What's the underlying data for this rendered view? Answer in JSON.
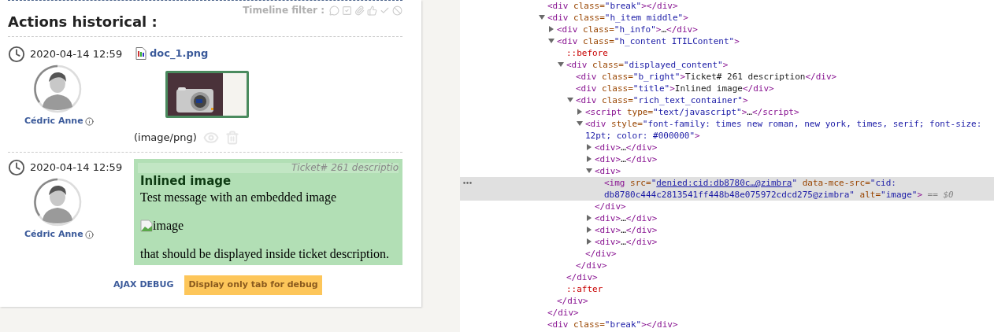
{
  "timeline": {
    "title": "Actions historical :",
    "filter_label": "Timeline filter :",
    "items": [
      {
        "kind": "document",
        "date": "2020-04-14 12:59",
        "author": "Cédric Anne",
        "file": "doc_1.png",
        "mime": "(image/png)"
      },
      {
        "kind": "description",
        "date": "2020-04-14 12:59",
        "author": "Cédric Anne",
        "ticket": "Ticket# 261 descriptio",
        "heading": "Inlined image",
        "text": "Test message with an embedded image",
        "image_alt": "image",
        "closing": "that should be displayed inside ticket description."
      }
    ],
    "debug_link": "AJAX DEBUG",
    "debug_button": "Display only tab for debug"
  },
  "inspector": {
    "nodes": [
      {
        "kind": "leaf",
        "selected": false,
        "line": [
          {
            "kind": "tag",
            "text": "<div"
          },
          {
            "kind": "attr",
            "text": " class="
          },
          {
            "kind": "val",
            "text": "\"break\""
          },
          {
            "kind": "tag",
            "text": "></div>"
          }
        ]
      },
      {
        "kind": "branch",
        "expanded": true,
        "selected": false,
        "line": [
          {
            "kind": "tag",
            "text": "<div"
          },
          {
            "kind": "attr",
            "text": " class="
          },
          {
            "kind": "val",
            "text": "\"h_item middle\""
          },
          {
            "kind": "tag",
            "text": ">"
          }
        ],
        "end": [
          {
            "kind": "tag",
            "text": "</div>"
          }
        ],
        "children": [
          {
            "kind": "branch",
            "expanded": false,
            "selected": false,
            "line": [
              {
                "kind": "tag",
                "text": "<div"
              },
              {
                "kind": "attr",
                "text": " class="
              },
              {
                "kind": "val",
                "text": "\"h_info\""
              },
              {
                "kind": "tag",
                "text": ">"
              },
              {
                "kind": "text",
                "text": "…"
              },
              {
                "kind": "tag",
                "text": "</div>"
              }
            ]
          },
          {
            "kind": "branch",
            "expanded": true,
            "selected": false,
            "line": [
              {
                "kind": "tag",
                "text": "<div"
              },
              {
                "kind": "attr",
                "text": " class="
              },
              {
                "kind": "val",
                "text": "\"h_content ITILContent\""
              },
              {
                "kind": "tag",
                "text": ">"
              }
            ],
            "end": [
              {
                "kind": "tag",
                "text": "</div>"
              }
            ],
            "children": [
              {
                "kind": "leaf",
                "selected": false,
                "line": [
                  {
                    "kind": "pseudo",
                    "text": "::before"
                  }
                ]
              },
              {
                "kind": "branch",
                "expanded": true,
                "selected": false,
                "line": [
                  {
                    "kind": "tag",
                    "text": "<div"
                  },
                  {
                    "kind": "attr",
                    "text": " class="
                  },
                  {
                    "kind": "val",
                    "text": "\"displayed_content\""
                  },
                  {
                    "kind": "tag",
                    "text": ">"
                  }
                ],
                "end": [
                  {
                    "kind": "tag",
                    "text": "</div>"
                  }
                ],
                "children": [
                  {
                    "kind": "leaf",
                    "selected": false,
                    "line": [
                      {
                        "kind": "tag",
                        "text": "<div"
                      },
                      {
                        "kind": "attr",
                        "text": " class="
                      },
                      {
                        "kind": "val",
                        "text": "\"b_right\""
                      },
                      {
                        "kind": "tag",
                        "text": ">"
                      },
                      {
                        "kind": "text",
                        "text": "Ticket# 261 description"
                      },
                      {
                        "kind": "tag",
                        "text": "</div>"
                      }
                    ]
                  },
                  {
                    "kind": "leaf",
                    "selected": false,
                    "line": [
                      {
                        "kind": "tag",
                        "text": "<div"
                      },
                      {
                        "kind": "attr",
                        "text": " class="
                      },
                      {
                        "kind": "val",
                        "text": "\"title\""
                      },
                      {
                        "kind": "tag",
                        "text": ">"
                      },
                      {
                        "kind": "text",
                        "text": "Inlined image"
                      },
                      {
                        "kind": "tag",
                        "text": "</div>"
                      }
                    ]
                  },
                  {
                    "kind": "branch",
                    "expanded": true,
                    "selected": false,
                    "line": [
                      {
                        "kind": "tag",
                        "text": "<div"
                      },
                      {
                        "kind": "attr",
                        "text": " class="
                      },
                      {
                        "kind": "val",
                        "text": "\"rich_text_container\""
                      },
                      {
                        "kind": "tag",
                        "text": ">"
                      }
                    ],
                    "end": [
                      {
                        "kind": "tag",
                        "text": "</div>"
                      }
                    ],
                    "children": [
                      {
                        "kind": "branch",
                        "expanded": false,
                        "selected": false,
                        "line": [
                          {
                            "kind": "tag",
                            "text": "<script"
                          },
                          {
                            "kind": "attr",
                            "text": " type="
                          },
                          {
                            "kind": "val",
                            "text": "\"text/javascript\""
                          },
                          {
                            "kind": "tag",
                            "text": ">"
                          },
                          {
                            "kind": "text",
                            "text": "…"
                          },
                          {
                            "kind": "tag",
                            "text": "</script>"
                          }
                        ]
                      },
                      {
                        "kind": "branch",
                        "expanded": true,
                        "selected": false,
                        "line": [
                          {
                            "kind": "tag",
                            "text": "<div"
                          },
                          {
                            "kind": "attr",
                            "text": " style="
                          },
                          {
                            "kind": "val",
                            "text": "\"font-family: times new roman, new york, times, serif; font-size: 12pt; color: #000000\""
                          },
                          {
                            "kind": "tag",
                            "text": ">"
                          }
                        ],
                        "end": [
                          {
                            "kind": "tag",
                            "text": "</div>"
                          }
                        ],
                        "children": [
                          {
                            "kind": "branch",
                            "expanded": false,
                            "selected": false,
                            "line": [
                              {
                                "kind": "tag",
                                "text": "<div>"
                              },
                              {
                                "kind": "text",
                                "text": "…"
                              },
                              {
                                "kind": "tag",
                                "text": "</div>"
                              }
                            ]
                          },
                          {
                            "kind": "branch",
                            "expanded": false,
                            "selected": false,
                            "line": [
                              {
                                "kind": "tag",
                                "text": "<div>"
                              },
                              {
                                "kind": "text",
                                "text": "…"
                              },
                              {
                                "kind": "tag",
                                "text": "</div>"
                              }
                            ]
                          },
                          {
                            "kind": "branch",
                            "expanded": true,
                            "selected": false,
                            "line": [
                              {
                                "kind": "tag",
                                "text": "<div>"
                              }
                            ],
                            "end": [
                              {
                                "kind": "tag",
                                "text": "</div>"
                              }
                            ],
                            "children": [
                              {
                                "kind": "leaf",
                                "selected": true,
                                "line": [
                                  {
                                    "kind": "tag",
                                    "text": "<img"
                                  },
                                  {
                                    "kind": "attr",
                                    "text": " src="
                                  },
                                  {
                                    "kind": "val",
                                    "text": "\""
                                  },
                                  {
                                    "kind": "link",
                                    "text": "denied:cid:db8780c…@zimbra"
                                  },
                                  {
                                    "kind": "val",
                                    "text": "\""
                                  },
                                  {
                                    "kind": "attr",
                                    "text": " data-mce-src="
                                  },
                                  {
                                    "kind": "val",
                                    "text": "\"cid:"
                                  },
                                  {
                                    "kind": "val",
                                    "text": "db8780c444c2813541ff448b48e075972cdcd275@zimbra\""
                                  },
                                  {
                                    "kind": "attr",
                                    "text": " alt="
                                  },
                                  {
                                    "kind": "val",
                                    "text": "\"image\""
                                  },
                                  {
                                    "kind": "tag",
                                    "text": ">"
                                  },
                                  {
                                    "kind": "ref",
                                    "text": " == $0"
                                  }
                                ]
                              }
                            ]
                          },
                          {
                            "kind": "branch",
                            "expanded": false,
                            "selected": false,
                            "line": [
                              {
                                "kind": "tag",
                                "text": "<div>"
                              },
                              {
                                "kind": "text",
                                "text": "…"
                              },
                              {
                                "kind": "tag",
                                "text": "</div>"
                              }
                            ]
                          },
                          {
                            "kind": "branch",
                            "expanded": false,
                            "selected": false,
                            "line": [
                              {
                                "kind": "tag",
                                "text": "<div>"
                              },
                              {
                                "kind": "text",
                                "text": "…"
                              },
                              {
                                "kind": "tag",
                                "text": "</div>"
                              }
                            ]
                          },
                          {
                            "kind": "branch",
                            "expanded": false,
                            "selected": false,
                            "line": [
                              {
                                "kind": "tag",
                                "text": "<div>"
                              },
                              {
                                "kind": "text",
                                "text": "…"
                              },
                              {
                                "kind": "tag",
                                "text": "</div>"
                              }
                            ]
                          }
                        ]
                      }
                    ]
                  }
                ]
              },
              {
                "kind": "leaf",
                "selected": false,
                "line": [
                  {
                    "kind": "pseudo",
                    "text": "::after"
                  }
                ]
              }
            ]
          }
        ]
      },
      {
        "kind": "leaf",
        "selected": false,
        "line": [
          {
            "kind": "tag",
            "text": "<div"
          },
          {
            "kind": "attr",
            "text": " class="
          },
          {
            "kind": "val",
            "text": "\"break\""
          },
          {
            "kind": "tag",
            "text": "></div>"
          }
        ]
      }
    ]
  }
}
